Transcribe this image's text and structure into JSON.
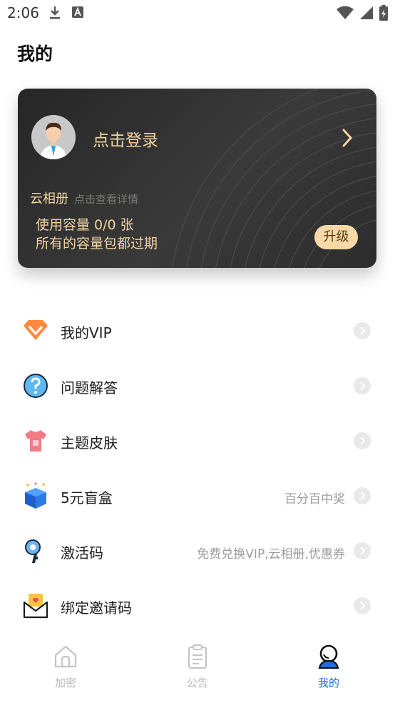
{
  "status_bar": {
    "time": "2:06"
  },
  "header": {
    "title": "我的"
  },
  "account_card": {
    "login_label": "点击登录",
    "cloud_album_title": "云相册",
    "cloud_album_hint": "点击查看详情",
    "capacity_text": "使用容量  0/0  张",
    "expire_text": "所有的容量包都过期",
    "upgrade_label": "升级"
  },
  "menu": {
    "items": [
      {
        "label": "我的VIP",
        "note": "",
        "icon": "vip-diamond-icon"
      },
      {
        "label": "问题解答",
        "note": "",
        "icon": "question-icon"
      },
      {
        "label": "主题皮肤",
        "note": "",
        "icon": "tshirt-icon"
      },
      {
        "label": "5元盲盒",
        "note": "百分百中奖",
        "icon": "blind-box-icon"
      },
      {
        "label": "激活码",
        "note": "免费兑换VIP,云相册,优惠券",
        "icon": "key-icon"
      },
      {
        "label": "绑定邀请码",
        "note": "",
        "icon": "invite-envelope-icon"
      }
    ]
  },
  "bottom_nav": {
    "tabs": [
      {
        "label": "加密",
        "icon": "home-icon"
      },
      {
        "label": "公告",
        "icon": "clipboard-icon"
      },
      {
        "label": "我的",
        "icon": "profile-icon",
        "active": true
      }
    ]
  },
  "colors": {
    "accent": "#1d6fe0",
    "gold": "#f3d4a2",
    "card": "#2c2c2c"
  }
}
